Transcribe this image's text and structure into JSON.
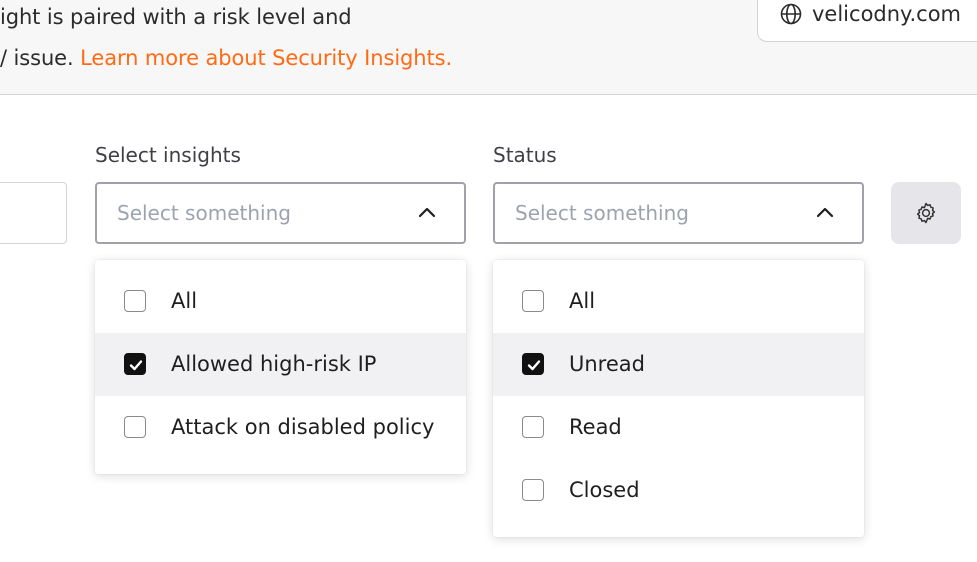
{
  "banner": {
    "line1": "ight is paired with a risk level and",
    "line2_prefix": "/ issue. ",
    "learn_more_link": "Learn more about Security Insights."
  },
  "domain": {
    "icon": "globe-icon",
    "text": "velicodny.com"
  },
  "filters": {
    "insights": {
      "label": "Select insights",
      "placeholder": "Select something",
      "expanded": true,
      "options": [
        {
          "label": "All",
          "checked": false
        },
        {
          "label": "Allowed high-risk IP",
          "checked": true
        },
        {
          "label": "Attack on disabled policy",
          "checked": false
        }
      ]
    },
    "status": {
      "label": "Status",
      "placeholder": "Select something",
      "expanded": true,
      "options": [
        {
          "label": "All",
          "checked": false
        },
        {
          "label": "Unread",
          "checked": true
        },
        {
          "label": "Read",
          "checked": false
        },
        {
          "label": "Closed",
          "checked": false
        }
      ]
    },
    "settings_icon": "gear-icon"
  },
  "colors": {
    "accent_link": "#ff6a13",
    "checkbox_checked": "#111111",
    "selected_row": "#f1f1f3"
  }
}
